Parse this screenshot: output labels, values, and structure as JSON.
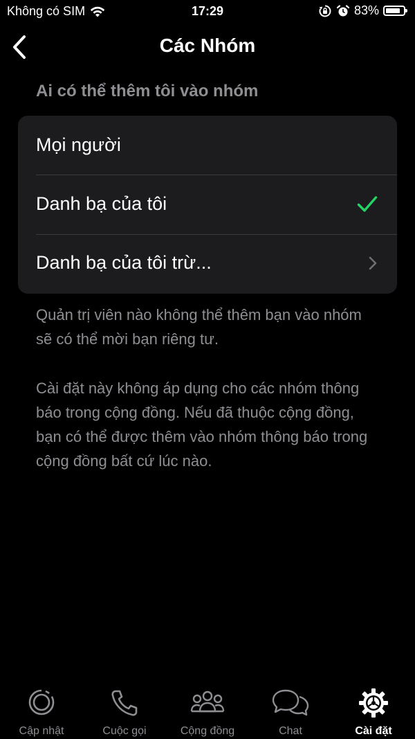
{
  "status_bar": {
    "carrier": "Không có SIM",
    "time": "17:29",
    "battery_percent": "83%",
    "battery_level": 0.83
  },
  "nav": {
    "title": "Các Nhóm",
    "back_icon": "chevron-left-icon"
  },
  "section": {
    "header": "Ai có thể thêm tôi vào nhóm",
    "options": [
      {
        "label": "Mọi người",
        "accessory": "none"
      },
      {
        "label": "Danh bạ của tôi",
        "accessory": "checkmark-icon",
        "selected": true
      },
      {
        "label": "Danh bạ của tôi trừ...",
        "accessory": "chevron-right-icon"
      }
    ]
  },
  "footnotes": [
    "Quản trị viên nào không thể thêm bạn vào nhóm sẽ có thể mời bạn riêng tư.",
    "Cài đặt này không áp dụng cho các nhóm thông báo trong cộng đồng. Nếu đã thuộc cộng đồng, bạn có thể được thêm vào nhóm thông báo trong cộng đồng bất cứ lúc nào."
  ],
  "tabbar": {
    "tabs": [
      {
        "label": "Cập nhật",
        "icon": "updates-icon"
      },
      {
        "label": "Cuộc gọi",
        "icon": "phone-icon"
      },
      {
        "label": "Cộng đồng",
        "icon": "communities-icon"
      },
      {
        "label": "Chat",
        "icon": "chat-icon"
      },
      {
        "label": "Cài đặt",
        "icon": "settings-gear-icon",
        "active": true
      }
    ]
  },
  "colors": {
    "background": "#000000",
    "cell": "#1c1c1e",
    "secondary_text": "#8e8e93",
    "accent_green": "#25d366",
    "divider": "#3a3a3c"
  }
}
